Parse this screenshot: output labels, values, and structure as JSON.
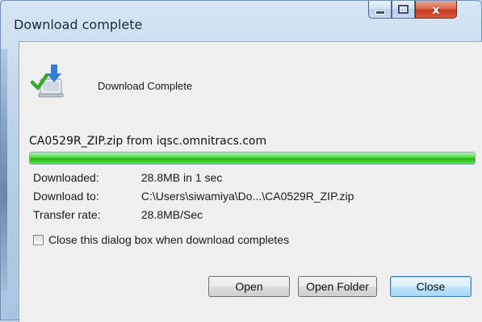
{
  "window": {
    "title": "Download complete",
    "close_glyph": "x",
    "caption_buttons": [
      "minimize-icon",
      "maximize-icon",
      "close-icon"
    ]
  },
  "header": {
    "icon": "download-check-icon",
    "text": "Download Complete"
  },
  "download": {
    "file_source": "CA0529R_ZIP.zip from iqsc.omnitracs.com",
    "progress_percent": 100,
    "progress_color": "#2fc31f"
  },
  "details": [
    {
      "label": "Downloaded:",
      "value": "28.8MB in 1 sec"
    },
    {
      "label": "Download to:",
      "value": "C:\\Users\\siwamiya\\Do...\\CA0529R_ZIP.zip"
    },
    {
      "label": "Transfer rate:",
      "value": "28.8MB/Sec"
    }
  ],
  "options": {
    "close_on_complete_label": "Close this dialog box when download completes",
    "close_on_complete_checked": false
  },
  "buttons": {
    "open": "Open",
    "open_folder": "Open Folder",
    "close": "Close"
  }
}
